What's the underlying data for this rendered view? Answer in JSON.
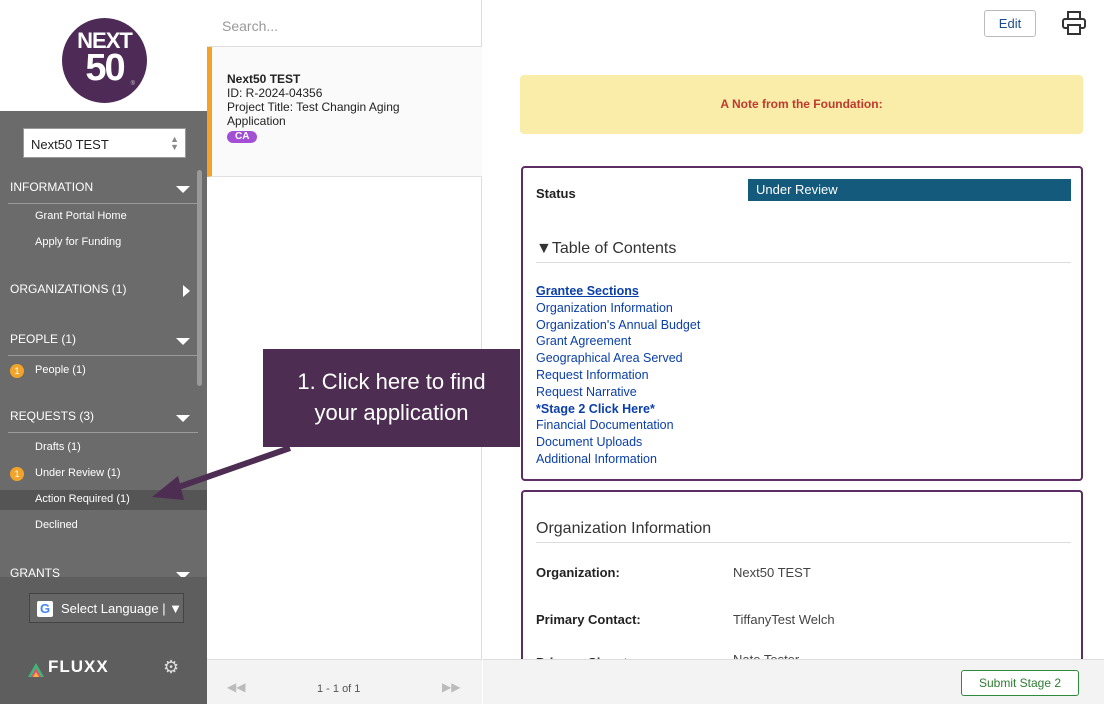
{
  "sidebar": {
    "logo": {
      "line1": "NEXT",
      "line2": "50",
      "reg": "®"
    },
    "org_select": {
      "value": "Next50 TEST"
    },
    "sections": [
      {
        "label": "INFORMATION"
      },
      {
        "label": "ORGANIZATIONS (1)"
      },
      {
        "label": "PEOPLE (1)"
      },
      {
        "label": "REQUESTS (3)"
      },
      {
        "label": "GRANTS"
      }
    ],
    "items": {
      "grant_portal_home": "Grant Portal Home",
      "apply_for_funding": "Apply for Funding",
      "people": "People  (1)",
      "drafts": "Drafts  (1)",
      "under_review": "Under Review  (1)",
      "action_required": "Action Required  (1)",
      "declined": "Declined"
    },
    "badges": {
      "people": "1",
      "under_review": "1"
    },
    "language_button": "Select Language | ▼",
    "brand": "FLUXX"
  },
  "list": {
    "search_placeholder": "Search...",
    "card": {
      "title": "Next50 TEST",
      "id": "ID: R-2024-04356",
      "project": "Project Title: Test Changin Aging Application",
      "tag": "CA"
    },
    "pager": {
      "prev": "◀◀",
      "info": "1 - 1 of 1",
      "next": "▶▶"
    }
  },
  "main": {
    "edit_label": "Edit",
    "note": "A Note from the Foundation:",
    "status_label": "Status",
    "status_value": "Under Review",
    "toc_title": "▼Table of Contents",
    "toc": [
      "Grantee Sections",
      "Organization Information",
      "Organization's Annual Budget",
      "Grant Agreement",
      "Geographical Area Served",
      "Request Information",
      "Request Narrative",
      "*Stage 2 Click Here*",
      "Financial Documentation",
      "Document Uploads",
      "Additional Information"
    ],
    "org_section_title": "Organization Information",
    "fields": [
      {
        "label": "Organization:",
        "value": "Next50 TEST"
      },
      {
        "label": "Primary Contact:",
        "value": "TiffanyTest Welch"
      },
      {
        "label": "Primary Signatory:",
        "value": "Nate Tester"
      }
    ],
    "submit_label": "Submit Stage 2"
  },
  "callout": {
    "line1": "1. Click here to find",
    "line2": "your application"
  },
  "colors": {
    "accent_purple": "#4d2e52",
    "status_blue": "#135a7c",
    "badge_orange": "#f2a42a",
    "note_yellow": "#faedaa"
  }
}
